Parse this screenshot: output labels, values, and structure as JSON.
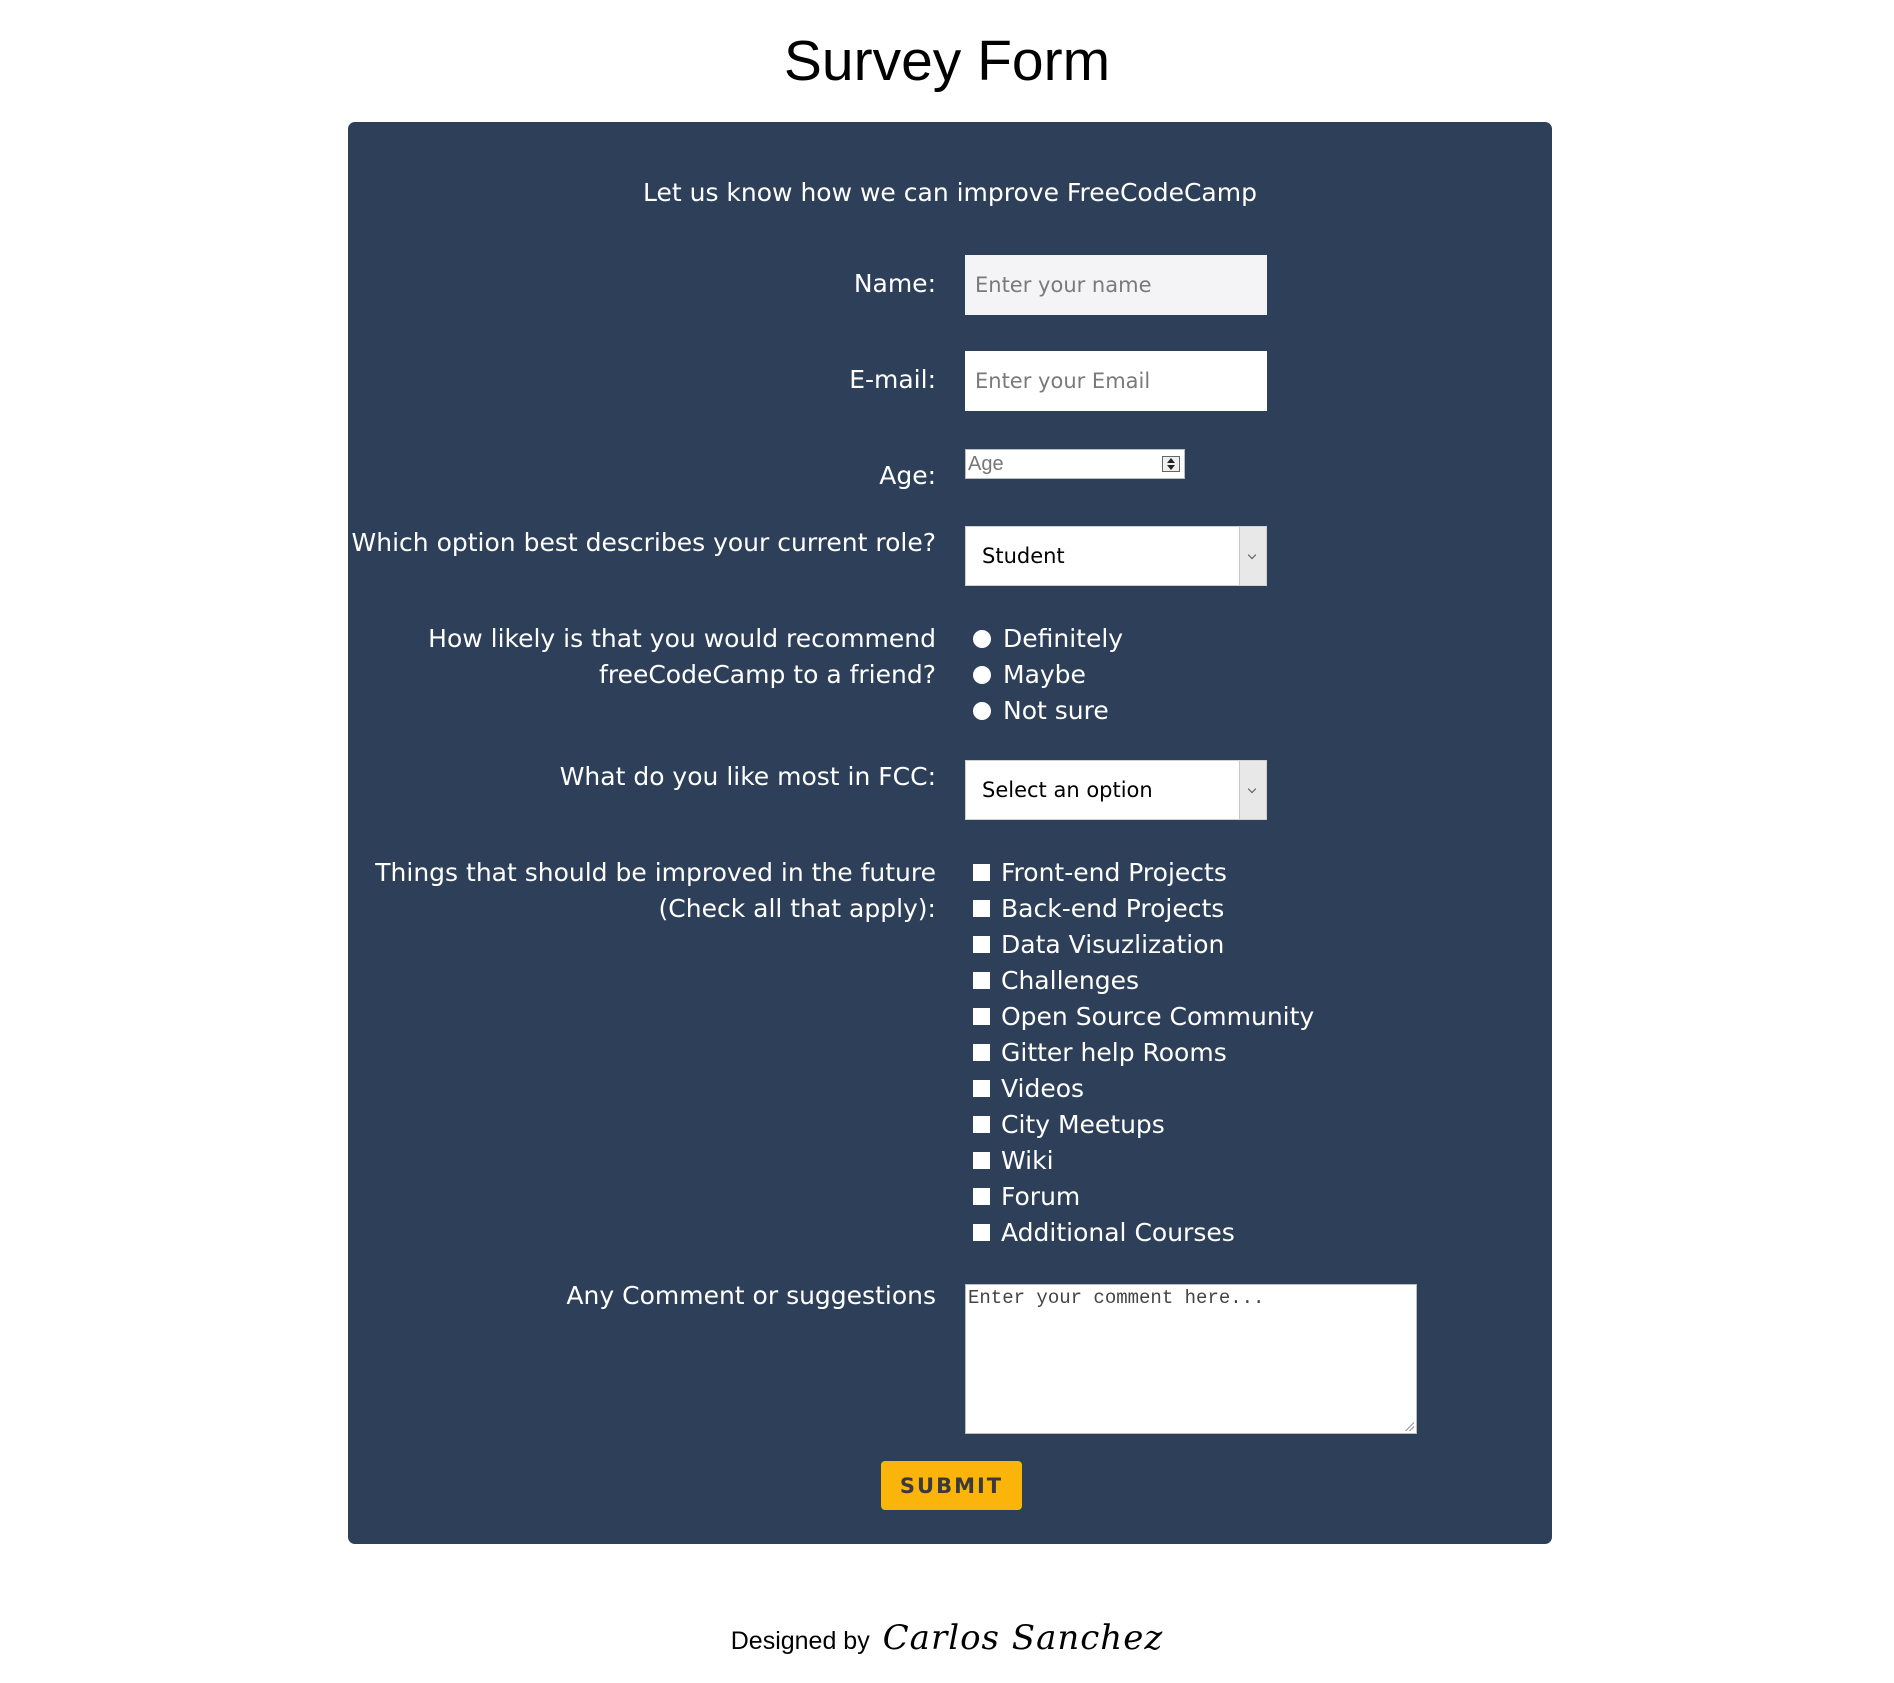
{
  "page": {
    "title": "Survey Form",
    "description": "Let us know how we can improve FreeCodeCamp"
  },
  "form": {
    "name_label": "Name:",
    "name_placeholder": "Enter your name",
    "email_label": "E-mail:",
    "email_placeholder": "Enter your Email",
    "age_label": "Age:",
    "age_placeholder": "Age",
    "role_label": "Which option best describes your current role?",
    "role_selected": "Student",
    "recommend_label_line1": "How likely is that you would recommend",
    "recommend_label_line2": "freeCodeCamp to a friend?",
    "recommend_options": [
      "Definitely",
      "Maybe",
      "Not sure"
    ],
    "like_label": "What do you like most in FCC:",
    "like_selected": "Select an option",
    "improve_label_line1": "Things that should be improved in the future",
    "improve_label_line2": "(Check all that apply):",
    "improve_options": [
      "Front-end Projects",
      "Back-end Projects",
      "Data Visuzlization",
      "Challenges",
      "Open Source Community",
      "Gitter help Rooms",
      "Videos",
      "City Meetups",
      "Wiki",
      "Forum",
      "Additional Courses"
    ],
    "comment_label": "Any Comment or suggestions",
    "comment_placeholder": "Enter your comment here...",
    "submit_label": "SUBMIT"
  },
  "footer": {
    "prefix": "Designed by",
    "author": "Carlos  Sanchez"
  },
  "colors": {
    "panel_background": "#2e4059",
    "submit_background": "#fbb40a"
  }
}
